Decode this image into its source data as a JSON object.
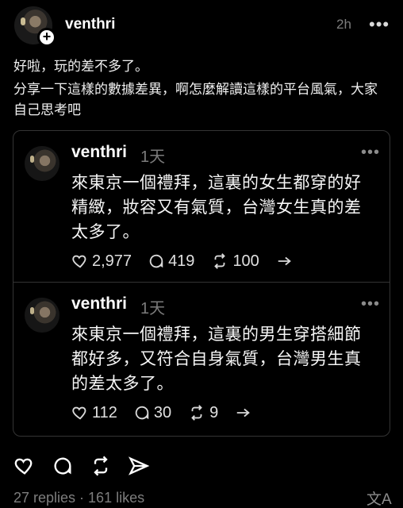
{
  "post": {
    "username": "venthri",
    "time": "2h",
    "more_icon": "•••",
    "line1": "好啦，玩的差不多了。",
    "line2": "分享一下這樣的數據差異，啊怎麼解讀這樣的平台風氣，大家自己思考吧",
    "follow_badge": "+",
    "stats": "27 replies · 161 likes",
    "translate_icon": "文A"
  },
  "quotes": [
    {
      "username": "venthri",
      "time": "1天",
      "more_icon": "•••",
      "text": "來東京一個禮拜，這裏的女生都穿的好精緻，妝容又有氣質，台灣女生真的差太多了。",
      "likes": "2,977",
      "comments": "419",
      "reposts": "100"
    },
    {
      "username": "venthri",
      "time": "1天",
      "more_icon": "•••",
      "text": "來東京一個禮拜，這裏的男生穿搭細節都好多，又符合自身氣質，台灣男生真的差太多了。",
      "likes": "112",
      "comments": "30",
      "reposts": "9"
    }
  ]
}
